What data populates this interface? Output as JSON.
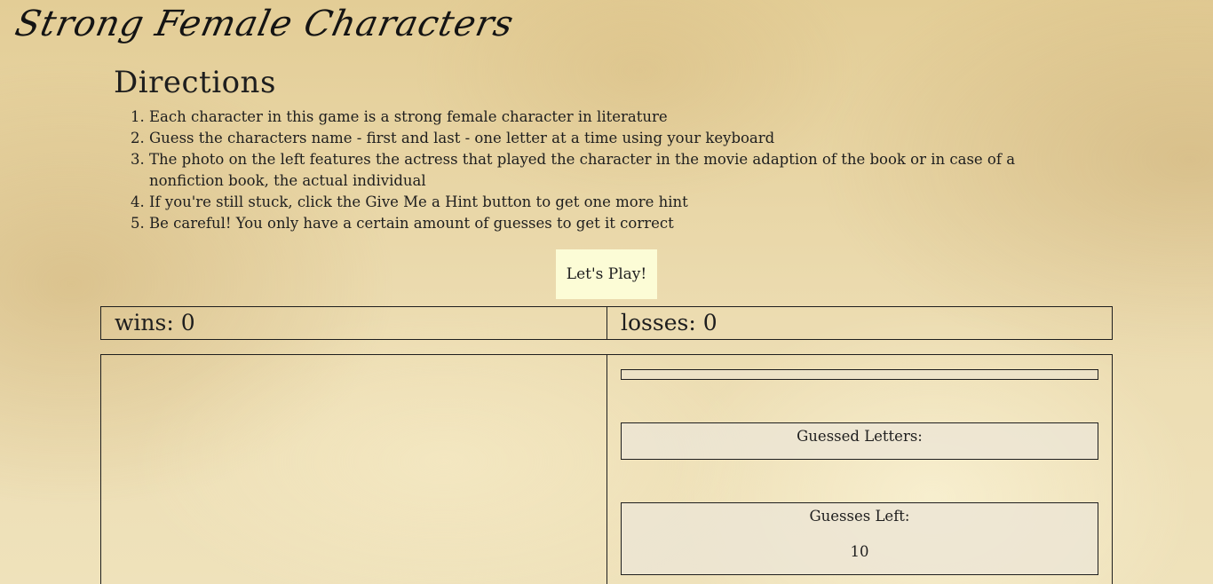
{
  "header": {
    "title": "Strong Female Characters"
  },
  "directions": {
    "heading": "Directions",
    "steps": [
      "Each character in this game is a strong female character in literature",
      "Guess the characters name - first and last - one letter at a time using your keyboard",
      "The photo on the left features the actress that played the character in the movie adaption of the book or in case of a nonfiction book, the actual individual",
      "If you're still stuck, click the Give Me a Hint button to get one more hint",
      "Be careful! You only have a certain amount of guesses to get it correct"
    ]
  },
  "play_button": {
    "label": "Let's Play!"
  },
  "score": {
    "wins": "wins: 0",
    "losses": "losses: 0"
  },
  "game": {
    "current_word": "",
    "guessed_letters_label": "Guessed Letters:",
    "guessed_letters": "",
    "guesses_left_label": "Guesses Left:",
    "guesses_left": "10"
  },
  "colors": {
    "button_bg": "#fcfcd6",
    "text": "#1e1e1e",
    "border": "#1e1e1e"
  }
}
